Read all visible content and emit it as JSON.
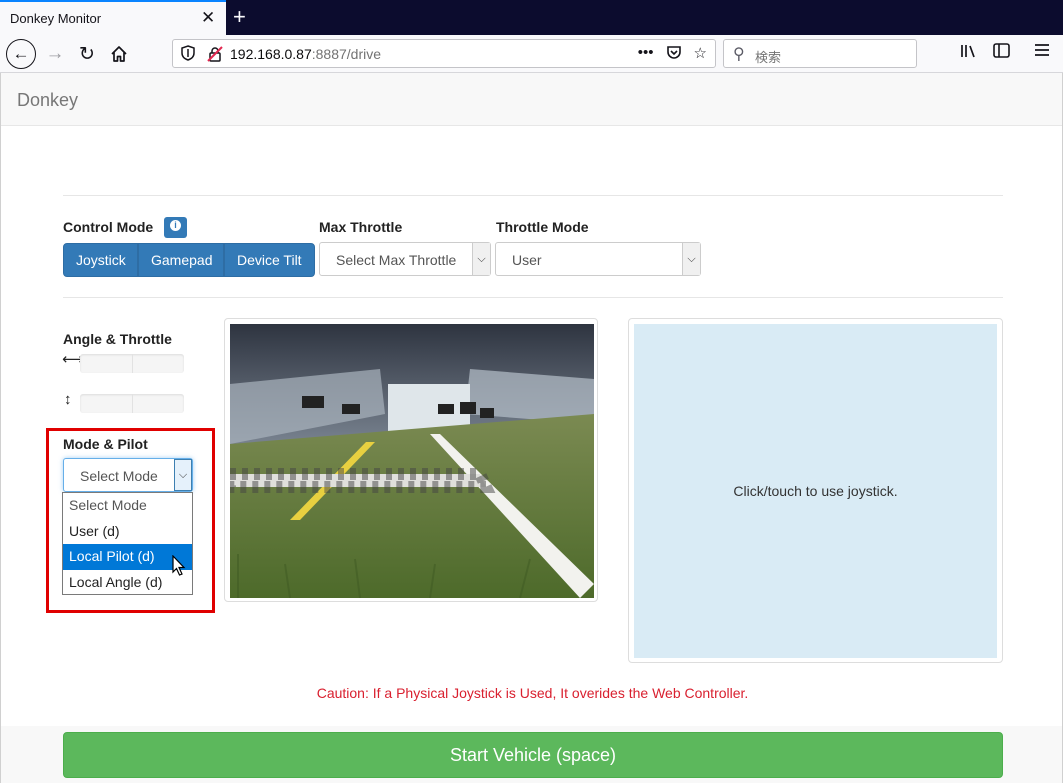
{
  "browser": {
    "tab_title": "Donkey Monitor",
    "tab_close": "✕",
    "new_tab": "+",
    "url_host": "192.168.0.87",
    "url_rest": ":8887/drive",
    "search_placeholder": "検索"
  },
  "app": {
    "brand": "Donkey"
  },
  "controls": {
    "control_mode_label": "Control Mode",
    "control_modes": [
      "Joystick",
      "Gamepad",
      "Device Tilt"
    ],
    "max_throttle_label": "Max Throttle",
    "max_throttle_value": "Select Max Throttle",
    "throttle_mode_label": "Throttle Mode",
    "throttle_mode_value": "User"
  },
  "telemetry": {
    "angle_throttle_label": "Angle & Throttle",
    "angle_icon": "⟷",
    "throttle_icon": "↕"
  },
  "mode_pilot": {
    "label": "Mode & Pilot",
    "selected": "Select Mode",
    "options": [
      "Select Mode",
      "User (d)",
      "Local Pilot (d)",
      "Local Angle (d)"
    ],
    "highlighted_option": "Local Pilot (d)"
  },
  "joystick": {
    "hint": "Click/touch to use joystick."
  },
  "caution": "Caution: If a Physical Joystick is Used, It overides the Web Controller.",
  "start_button": "Start Vehicle (space)",
  "colors": {
    "primary": "#337ab7",
    "success": "#5cb85c",
    "danger": "#d9202f",
    "highlight_box": "#e00000",
    "joystick_pad": "#d9ebf5"
  }
}
